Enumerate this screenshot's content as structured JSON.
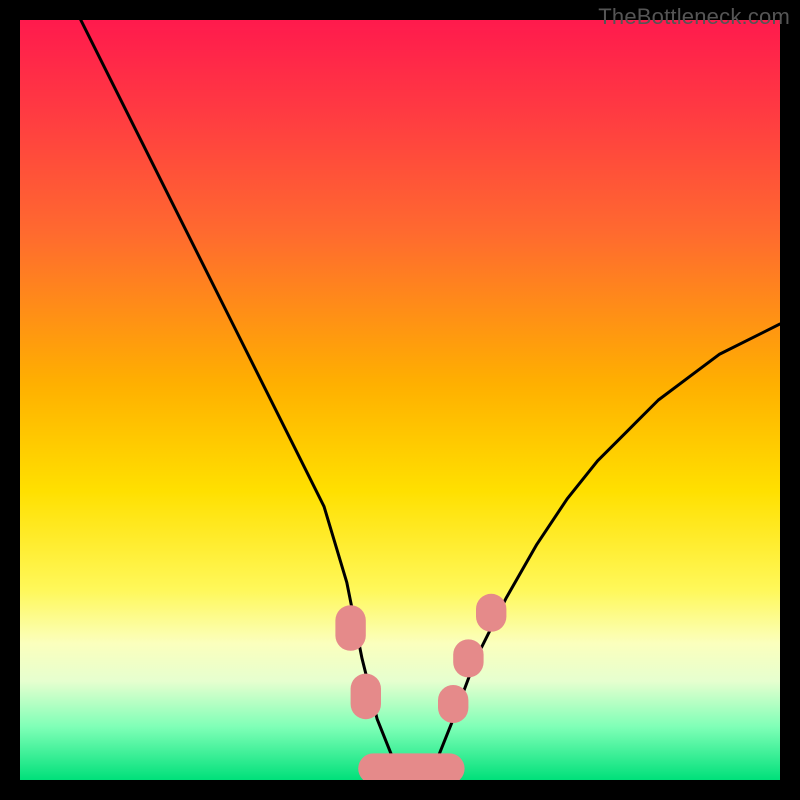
{
  "watermark": "TheBottleneck.com",
  "chart_data": {
    "type": "line",
    "title": "",
    "xlabel": "",
    "ylabel": "",
    "xlim": [
      0,
      100
    ],
    "ylim": [
      0,
      100
    ],
    "series": [
      {
        "name": "curve",
        "x": [
          8,
          12,
          16,
          20,
          24,
          28,
          32,
          36,
          40,
          43,
          45,
          47,
          49,
          51,
          53,
          55,
          57,
          60,
          64,
          68,
          72,
          76,
          80,
          84,
          88,
          92,
          96,
          100
        ],
        "values": [
          100,
          92,
          84,
          76,
          68,
          60,
          52,
          44,
          36,
          26,
          16,
          8,
          3,
          1,
          1,
          3,
          8,
          16,
          24,
          31,
          37,
          42,
          46,
          50,
          53,
          56,
          58,
          60
        ]
      }
    ],
    "markers": [
      {
        "name": "left-upper",
        "x": 43.5,
        "y": 20,
        "rx": 2.0,
        "ry": 3.0
      },
      {
        "name": "left-lower",
        "x": 45.5,
        "y": 11,
        "rx": 2.0,
        "ry": 3.0
      },
      {
        "name": "right-lower",
        "x": 57.0,
        "y": 10,
        "rx": 2.0,
        "ry": 2.5
      },
      {
        "name": "right-mid",
        "x": 59.0,
        "y": 16,
        "rx": 2.0,
        "ry": 2.5
      },
      {
        "name": "right-upper",
        "x": 62.0,
        "y": 22,
        "rx": 2.0,
        "ry": 2.5
      },
      {
        "name": "bottom-bar",
        "x": 51.5,
        "y": 1.5,
        "rx": 7.0,
        "ry": 2.0
      }
    ],
    "marker_color": "#e58a8a",
    "curve_color": "#000000"
  }
}
